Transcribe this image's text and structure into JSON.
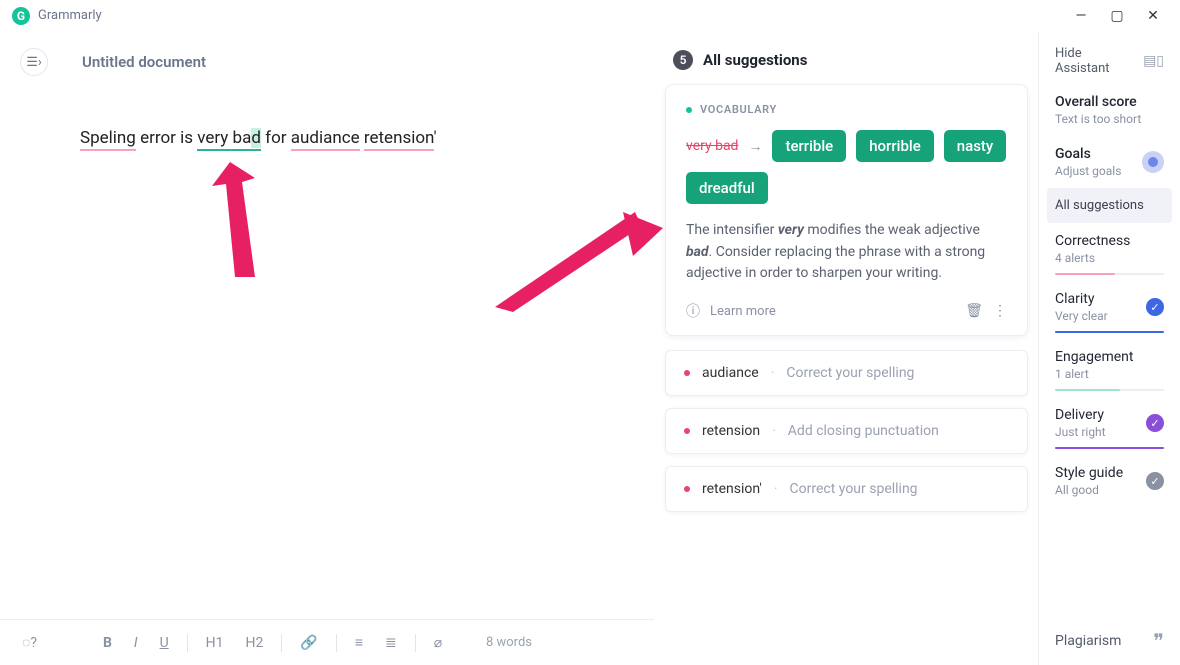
{
  "app": {
    "name": "Grammarly"
  },
  "document": {
    "title": "Untitled document"
  },
  "editor": {
    "text": {
      "w1": "Speling",
      "w2": "error is",
      "w3_prefix": "very ba",
      "w3_hl": "d",
      "w4": "for",
      "w5": "audiance",
      "w6": "retension",
      "tail": "'"
    },
    "footer": {
      "bold": "B",
      "italic": "I",
      "underline": "U",
      "h1": "H1",
      "h2": "H2",
      "word_count": "8 words"
    }
  },
  "suggestions": {
    "count": "5",
    "header": "All suggestions",
    "expanded": {
      "category": "VOCABULARY",
      "from": "very bad",
      "arrow": "→",
      "options": [
        "terrible",
        "horrible",
        "nasty",
        "dreadful"
      ],
      "explain_pre": "The intensifier ",
      "explain_i1": "very",
      "explain_mid1": " modifies the weak adjective ",
      "explain_i2": "bad",
      "explain_mid2": ". Consider replacing the phrase with a strong adjective in order to sharpen your writing.",
      "learn": "Learn more"
    },
    "items": [
      {
        "term": "audiance",
        "hint": "Correct your spelling",
        "sep": "·"
      },
      {
        "term": "retension",
        "hint": "Add closing punctuation",
        "sep": "·"
      },
      {
        "term": "retension'",
        "hint": "Correct your spelling",
        "sep": "·"
      }
    ]
  },
  "side": {
    "hide": "Hide Assistant",
    "score": {
      "title": "Overall score",
      "sub": "Text is too short"
    },
    "goals": {
      "title": "Goals",
      "sub": "Adjust goals"
    },
    "tab_all": "All suggestions",
    "metrics": {
      "correctness": {
        "title": "Correctness",
        "sub": "4 alerts",
        "color": "#f5a4b8",
        "fill": "55%"
      },
      "clarity": {
        "title": "Clarity",
        "sub": "Very clear",
        "color": "#3e67e3",
        "fill": "100%",
        "badge": "#3e67e3"
      },
      "engagement": {
        "title": "Engagement",
        "sub": "1 alert",
        "color": "#9fe3cf",
        "fill": "60%"
      },
      "delivery": {
        "title": "Delivery",
        "sub": "Just right",
        "color": "#8a4fd8",
        "fill": "100%",
        "badge": "#8a4fd8"
      },
      "style": {
        "title": "Style guide",
        "sub": "All good",
        "badge": "#8a91a3"
      }
    },
    "plagiarism": "Plagiarism"
  }
}
